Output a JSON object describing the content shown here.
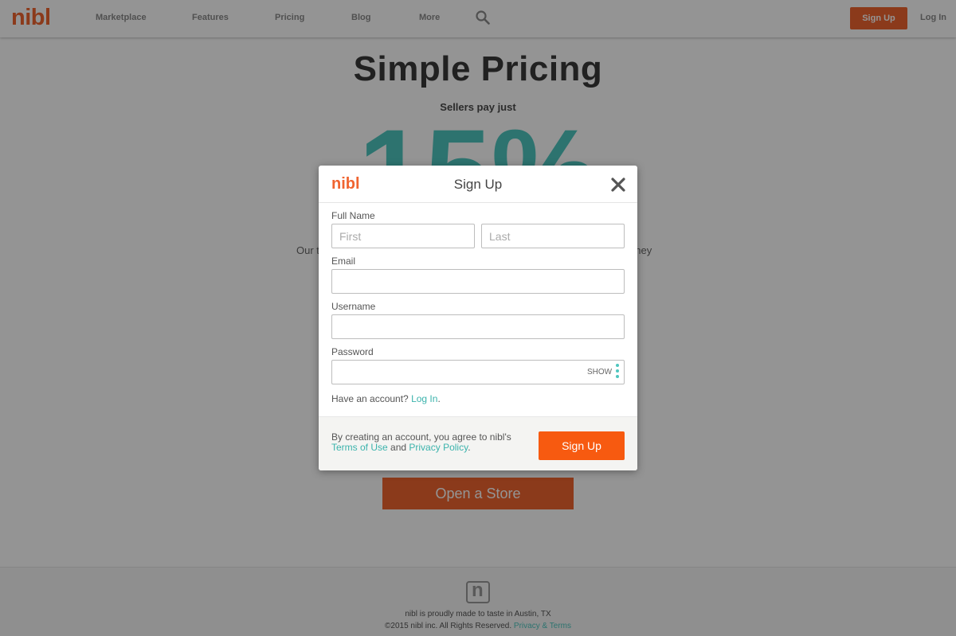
{
  "header": {
    "logo": "nibl",
    "nav": [
      "Marketplace",
      "Features",
      "Pricing",
      "Blog",
      "More"
    ],
    "signup_label": "Sign Up",
    "login_label": "Log In"
  },
  "hero": {
    "title": "Simple Pricing",
    "subtitle": "Sellers pay just",
    "percent": "15%",
    "desc_left": "Our t",
    "desc_right": "oney",
    "cta_label": "Open a Store"
  },
  "footer": {
    "icon_letter": "n",
    "line1": "nibl is proudly made to taste in Austin, TX",
    "line2": "©2015 nibl inc. All Rights Reserved.",
    "links": "Privacy & Terms"
  },
  "modal": {
    "logo": "nibl",
    "title": "Sign Up",
    "full_name_label": "Full Name",
    "first_placeholder": "First",
    "last_placeholder": "Last",
    "email_label": "Email",
    "username_label": "Username",
    "password_label": "Password",
    "show_label": "SHOW",
    "have_account": "Have an account? ",
    "login_link": "Log In",
    "login_period": ".",
    "terms_prefix": "By creating an account, you agree to nibl's ",
    "terms_link": "Terms of Use",
    "terms_and": " and ",
    "privacy_link": "Privacy Policy",
    "terms_period": ".",
    "signup_button": "Sign Up"
  },
  "colors": {
    "brand_orange": "#f06430",
    "accent_teal": "#4ec6bf",
    "signup_button": "#f75a10"
  }
}
